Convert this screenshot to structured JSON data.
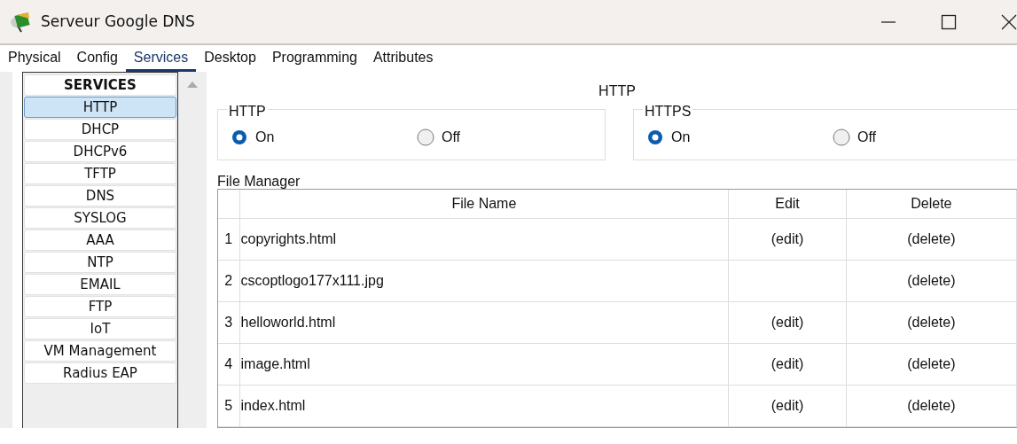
{
  "window": {
    "title": "Serveur Google DNS"
  },
  "tabs": [
    {
      "label": "Physical",
      "selected": false
    },
    {
      "label": "Config",
      "selected": false
    },
    {
      "label": "Services",
      "selected": true
    },
    {
      "label": "Desktop",
      "selected": false
    },
    {
      "label": "Programming",
      "selected": false
    },
    {
      "label": "Attributes",
      "selected": false
    }
  ],
  "sidebar": {
    "heading": "SERVICES",
    "items": [
      {
        "label": "HTTP",
        "selected": true
      },
      {
        "label": "DHCP",
        "selected": false
      },
      {
        "label": "DHCPv6",
        "selected": false
      },
      {
        "label": "TFTP",
        "selected": false
      },
      {
        "label": "DNS",
        "selected": false
      },
      {
        "label": "SYSLOG",
        "selected": false
      },
      {
        "label": "AAA",
        "selected": false
      },
      {
        "label": "NTP",
        "selected": false
      },
      {
        "label": "EMAIL",
        "selected": false
      },
      {
        "label": "FTP",
        "selected": false
      },
      {
        "label": "IoT",
        "selected": false
      },
      {
        "label": "VM Management",
        "selected": false
      },
      {
        "label": "Radius EAP",
        "selected": false
      }
    ]
  },
  "panel": {
    "title": "HTTP",
    "groups": [
      {
        "legend": "HTTP",
        "options": [
          {
            "label": "On",
            "selected": true
          },
          {
            "label": "Off",
            "selected": false
          }
        ]
      },
      {
        "legend": "HTTPS",
        "options": [
          {
            "label": "On",
            "selected": true
          },
          {
            "label": "Off",
            "selected": false
          }
        ]
      }
    ]
  },
  "file_manager": {
    "label": "File Manager",
    "columns": [
      "File Name",
      "Edit",
      "Delete"
    ],
    "rows": [
      {
        "index": "1",
        "file": "copyrights.html",
        "edit": "(edit)",
        "delete": "(delete)"
      },
      {
        "index": "2",
        "file": "cscoptlogo177x111.jpg",
        "delete": "(delete)"
      },
      {
        "index": "3",
        "file": "helloworld.html",
        "edit": "(edit)",
        "delete": "(delete)"
      },
      {
        "index": "4",
        "file": "image.html",
        "edit": "(edit)",
        "delete": "(delete)"
      },
      {
        "index": "5",
        "file": "index.html",
        "edit": "(edit)",
        "delete": "(delete)"
      }
    ]
  }
}
